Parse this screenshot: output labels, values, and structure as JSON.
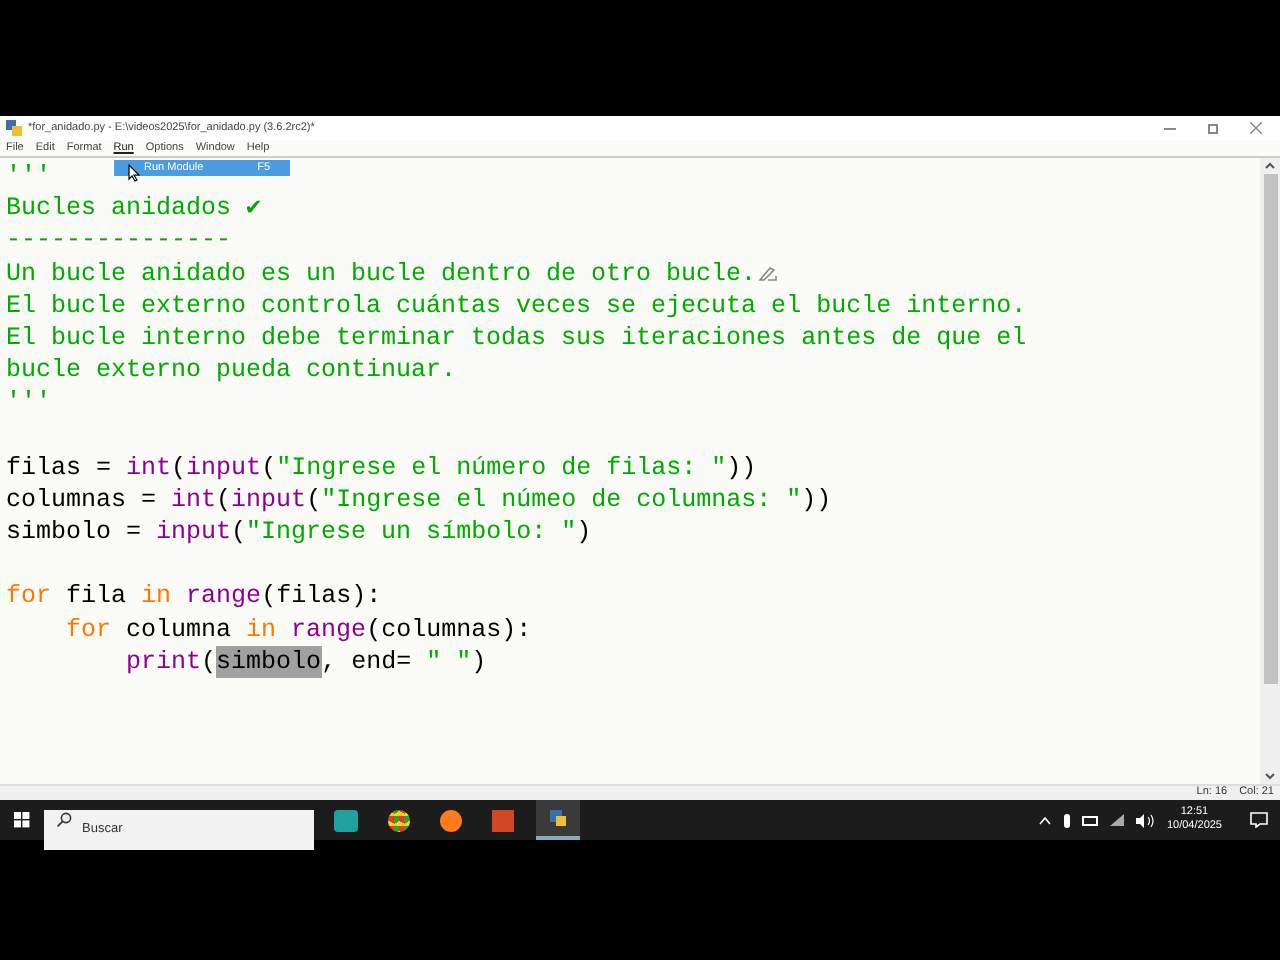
{
  "window": {
    "title": "*for_anidado.py - E:\\videos2025\\for_anidado.py (3.6.2rc2)*"
  },
  "menu": [
    {
      "label": "File",
      "selected": false
    },
    {
      "label": "Edit",
      "selected": false
    },
    {
      "label": "Format",
      "selected": false
    },
    {
      "label": "Run",
      "selected": true
    },
    {
      "label": "Options",
      "selected": false
    },
    {
      "label": "Window",
      "selected": false
    },
    {
      "label": "Help",
      "selected": false
    }
  ],
  "dropdown": [
    {
      "label": "Run Module",
      "shortcut": "F5",
      "selected": true
    }
  ],
  "editor": {
    "lines": [
      {
        "kind": "code",
        "tokens": [
          {
            "kind": "string",
            "text": "'''"
          }
        ]
      },
      {
        "kind": "code",
        "tokens": [
          {
            "kind": "string",
            "text": "Bucles anidados ✔"
          }
        ]
      },
      {
        "kind": "code",
        "tokens": [
          {
            "kind": "string",
            "text": "---------------"
          }
        ]
      },
      {
        "kind": "code",
        "tokens": [
          {
            "kind": "string",
            "text": "Un bucle anidado es un bucle dentro de otro bucle."
          },
          {
            "kind": "pencil"
          }
        ]
      },
      {
        "kind": "code",
        "tokens": [
          {
            "kind": "string",
            "text": "El bucle externo controla cuántas veces se ejecuta el bucle interno."
          }
        ]
      },
      {
        "kind": "code",
        "tokens": [
          {
            "kind": "string",
            "text": "El bucle interno debe terminar todas sus iteraciones antes de que el"
          }
        ]
      },
      {
        "kind": "code",
        "tokens": [
          {
            "kind": "string",
            "text": "bucle externo pueda continuar."
          }
        ]
      },
      {
        "kind": "code",
        "tokens": [
          {
            "kind": "string",
            "text": "'''"
          }
        ]
      },
      {
        "kind": "blank"
      },
      {
        "kind": "code",
        "tokens": [
          {
            "kind": "plain",
            "text": "filas = "
          },
          {
            "kind": "builtin",
            "text": "int"
          },
          {
            "kind": "plain",
            "text": "("
          },
          {
            "kind": "builtin",
            "text": "input"
          },
          {
            "kind": "plain",
            "text": "("
          },
          {
            "kind": "string",
            "text": "\"Ingrese el número de filas: \""
          },
          {
            "kind": "plain",
            "text": "))"
          }
        ]
      },
      {
        "kind": "code",
        "tokens": [
          {
            "kind": "plain",
            "text": "columnas = "
          },
          {
            "kind": "builtin",
            "text": "int"
          },
          {
            "kind": "plain",
            "text": "("
          },
          {
            "kind": "builtin",
            "text": "input"
          },
          {
            "kind": "plain",
            "text": "("
          },
          {
            "kind": "string",
            "text": "\"Ingrese el númeo de columnas: \""
          },
          {
            "kind": "plain",
            "text": "))"
          }
        ]
      },
      {
        "kind": "code",
        "tokens": [
          {
            "kind": "plain",
            "text": "simbolo = "
          },
          {
            "kind": "builtin",
            "text": "input"
          },
          {
            "kind": "plain",
            "text": "("
          },
          {
            "kind": "string",
            "text": "\"Ingrese un símbolo: \""
          },
          {
            "kind": "plain",
            "text": ")"
          }
        ]
      },
      {
        "kind": "blank"
      },
      {
        "kind": "code",
        "tokens": [
          {
            "kind": "keyword",
            "text": "for"
          },
          {
            "kind": "plain",
            "text": " fila "
          },
          {
            "kind": "keyword",
            "text": "in"
          },
          {
            "kind": "builtin",
            "text": " range"
          },
          {
            "kind": "plain",
            "text": "(filas):"
          }
        ]
      },
      {
        "kind": "code",
        "tokens": [
          {
            "kind": "keyword",
            "text": "    for"
          },
          {
            "kind": "plain",
            "text": " columna "
          },
          {
            "kind": "keyword",
            "text": "in"
          },
          {
            "kind": "builtin",
            "text": " range"
          },
          {
            "kind": "plain",
            "text": "(columnas):"
          }
        ]
      },
      {
        "kind": "code",
        "tokens": [
          {
            "kind": "builtin",
            "text": "        print"
          },
          {
            "kind": "plain",
            "text": "("
          },
          {
            "kind": "highlight",
            "text": "simbolo"
          },
          {
            "kind": "plain",
            "text": ", end= "
          },
          {
            "kind": "string",
            "text": "\" \""
          },
          {
            "kind": "plain",
            "text": ")"
          }
        ]
      }
    ]
  },
  "status_bar": {
    "line": "Ln: 16",
    "col": "Col: 21"
  },
  "taskbar": {
    "search_placeholder": "Buscar",
    "time": "12:51",
    "date": "10/04/2025"
  }
}
